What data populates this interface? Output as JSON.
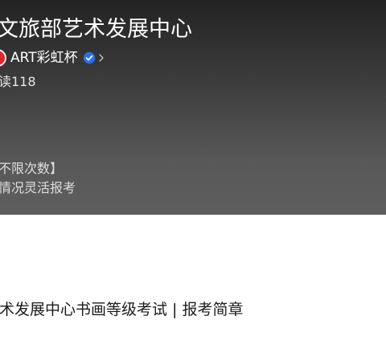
{
  "header": {
    "title": "文旅部艺术发展中心",
    "author": {
      "name": "ART彩虹杯",
      "avatar_color": "#e0262e",
      "verified_icon": "verified-check-icon",
      "verified_color": "#2b6fe6"
    },
    "read_count": "读118",
    "promo_lines": [
      "不限次数】",
      "情况灵活报考"
    ]
  },
  "content": {
    "article_title": "术发展中心书画等级考试 | 报考简章"
  }
}
